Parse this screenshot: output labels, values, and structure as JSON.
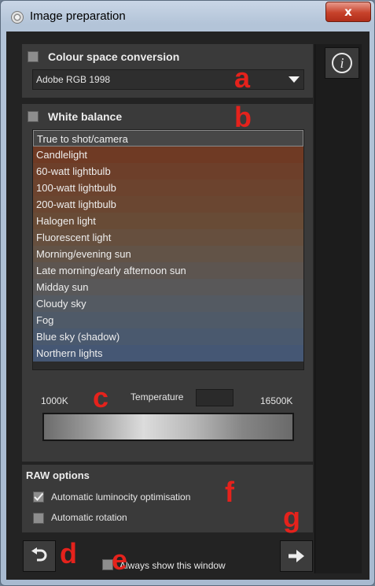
{
  "window": {
    "title": "Image preparation",
    "close_glyph": "x"
  },
  "info_button": {
    "glyph": "i",
    "icon": "info-icon"
  },
  "colour_space": {
    "label": "Colour space conversion",
    "checked": false,
    "selected": "Adobe RGB 1998"
  },
  "white_balance": {
    "label": "White balance",
    "checked": false,
    "items": [
      {
        "label": "True to shot/camera",
        "color": "#474747"
      },
      {
        "label": "Candlelight",
        "color": "#6f3a24"
      },
      {
        "label": "60-watt lightbulb",
        "color": "#6d3f2a"
      },
      {
        "label": "100-watt lightbulb",
        "color": "#6c432e"
      },
      {
        "label": "200-watt lightbulb",
        "color": "#6a4631"
      },
      {
        "label": "Halogen light",
        "color": "#684b36"
      },
      {
        "label": "Fluorescent light",
        "color": "#664f3e"
      },
      {
        "label": "Morning/evening sun",
        "color": "#625347"
      },
      {
        "label": "Late morning/early afternoon sun",
        "color": "#5d5550"
      },
      {
        "label": "Midday sun",
        "color": "#595859"
      },
      {
        "label": "Cloudy sky",
        "color": "#545a62"
      },
      {
        "label": "Fog",
        "color": "#4f5a68"
      },
      {
        "label": "Blue sky (shadow)",
        "color": "#4a596e"
      },
      {
        "label": "Northern lights",
        "color": "#455774"
      }
    ]
  },
  "temperature": {
    "label": "Temperature",
    "min": "1000K",
    "max": "16500K",
    "value": ""
  },
  "raw": {
    "title": "RAW options",
    "auto_luminocity": {
      "label": "Automatic luminocity optimisation",
      "checked": true
    },
    "auto_rotation": {
      "label": "Automatic rotation",
      "checked": false
    }
  },
  "footer": {
    "always_show_label": "Always show this window",
    "always_show_checked": false,
    "back_glyph": "↶",
    "next_glyph": "➡"
  },
  "annotations": {
    "a": "a",
    "b": "b",
    "c": "c",
    "d": "d",
    "e": "e",
    "f": "f",
    "g": "g"
  }
}
